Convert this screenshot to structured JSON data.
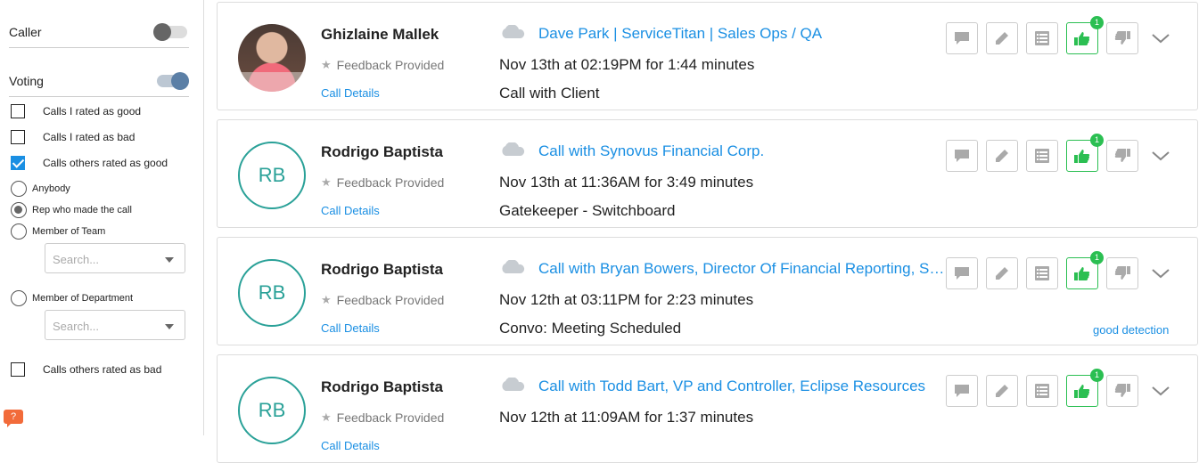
{
  "sidebar": {
    "caller_label": "Caller",
    "caller_on": false,
    "voting_label": "Voting",
    "voting_on": true,
    "checkboxes": [
      {
        "label": "Calls I rated as good",
        "checked": false
      },
      {
        "label": "Calls I rated as bad",
        "checked": false
      },
      {
        "label": "Calls others rated as good",
        "checked": true
      }
    ],
    "radios": [
      {
        "label": "Anybody",
        "selected": false
      },
      {
        "label": "Rep who made the call",
        "selected": true
      },
      {
        "label": "Member of Team",
        "selected": false
      },
      {
        "label": "Member of Department",
        "selected": false
      }
    ],
    "team_search_placeholder": "Search...",
    "dept_search_placeholder": "Search...",
    "last_checkbox": {
      "label": "Calls others rated as bad",
      "checked": false
    },
    "help_icon": "?"
  },
  "calls": [
    {
      "rep": "Ghizlaine Mallek",
      "avatar": "photo",
      "initials": "",
      "feedback": "Feedback Provided",
      "details": "Call Details",
      "title": "Dave Park | ServiceTitan | Sales Ops / QA",
      "when": "Nov 13th at 02:19PM for 1:44 minutes",
      "purpose": "Call with Client",
      "good_count": "1",
      "tag": ""
    },
    {
      "rep": "Rodrigo Baptista",
      "avatar": "initials",
      "initials": "RB",
      "feedback": "Feedback Provided",
      "details": "Call Details",
      "title": "Call with Synovus Financial Corp.",
      "when": "Nov 13th at 11:36AM for 3:49 minutes",
      "purpose": "Gatekeeper - Switchboard",
      "good_count": "1",
      "tag": ""
    },
    {
      "rep": "Rodrigo Baptista",
      "avatar": "initials",
      "initials": "RB",
      "feedback": "Feedback Provided",
      "details": "Call Details",
      "title": "Call with Bryan Bowers, Director Of Financial Reporting, Synovus",
      "when": "Nov 12th at 03:11PM for 2:23 minutes",
      "purpose": "Convo: Meeting Scheduled",
      "good_count": "1",
      "tag": "good detection"
    },
    {
      "rep": "Rodrigo Baptista",
      "avatar": "initials",
      "initials": "RB",
      "feedback": "Feedback Provided",
      "details": "Call Details",
      "title": "Call with Todd Bart, VP and Controller, Eclipse Resources",
      "when": "Nov 12th at 11:09AM for 1:37 minutes",
      "purpose": "",
      "good_count": "1",
      "tag": ""
    }
  ],
  "colors": {
    "accent": "#1a8fe3",
    "good": "#2bbf52",
    "initials": "#2aa198",
    "toggle_on": "#5b7fa6"
  },
  "icons": [
    "cloud-icon",
    "comment-icon",
    "pencil-icon",
    "list-icon",
    "thumbs-up-icon",
    "thumbs-down-icon",
    "chevron-down-icon",
    "star-icon"
  ]
}
